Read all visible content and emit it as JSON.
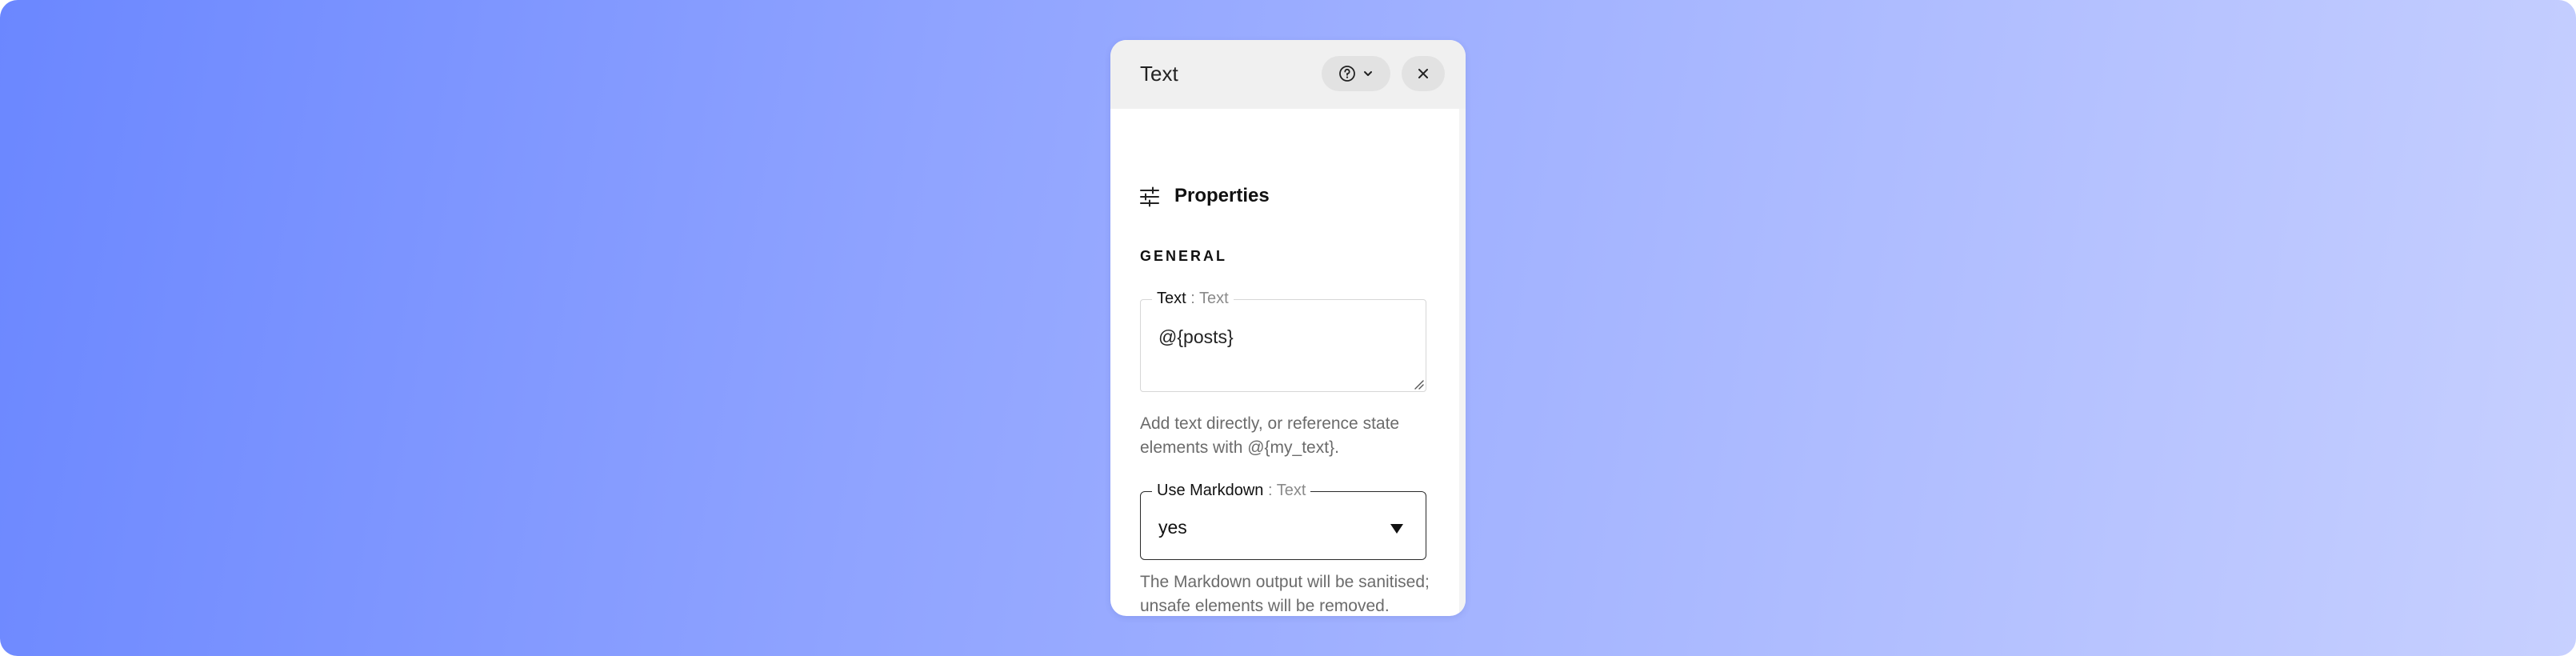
{
  "panel": {
    "title": "Text",
    "help_icon": "help-circle-icon",
    "dropdown_icon": "chevron-down-icon",
    "close_icon": "close-icon"
  },
  "properties": {
    "icon": "sliders-icon",
    "title": "Properties"
  },
  "section": {
    "label": "GENERAL"
  },
  "fields": {
    "text": {
      "label": "Text",
      "type": " : Text",
      "value": "@{posts}",
      "help": "Add text directly, or reference state elements with @{my_text}."
    },
    "markdown": {
      "label": "Use Markdown",
      "type": " : Text",
      "value": "yes",
      "help": "The Markdown output will be sanitised; unsafe elements will be removed."
    }
  },
  "colors": {
    "gradient_start": "#6b87ff",
    "gradient_end": "#c7d0ff",
    "header_bg": "#f0f0f0",
    "button_bg": "#e2e2e2"
  }
}
